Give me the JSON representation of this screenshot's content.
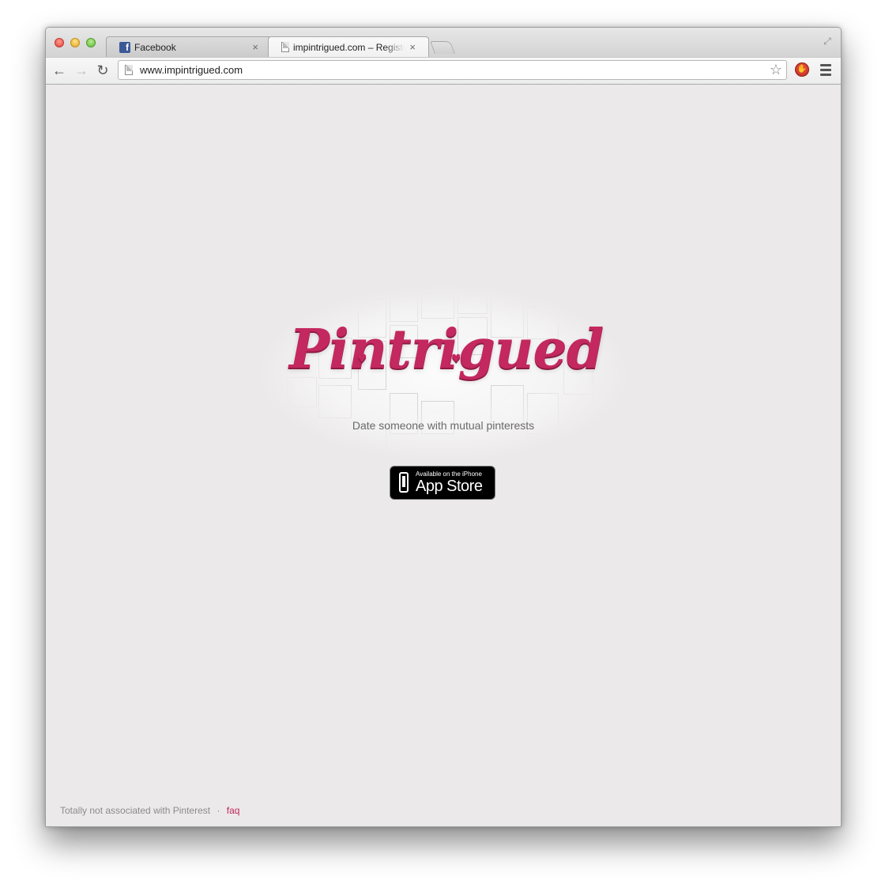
{
  "browser": {
    "tabs": [
      {
        "title": "Facebook",
        "icon": "facebook-icon",
        "active": false
      },
      {
        "title": "impintrigued.com – Register",
        "icon": "page-icon",
        "active": true
      }
    ],
    "url": "www.impintrigued.com",
    "close_glyph": "×"
  },
  "page": {
    "logo": "Pintrigued",
    "tagline": "Date someone with mutual pinterests",
    "appstore": {
      "small": "Available on the iPhone",
      "big": "App Store"
    },
    "footer": {
      "note": "Totally not associated with Pinterest",
      "separator": "·",
      "faq": "faq"
    }
  },
  "colors": {
    "brand": "#c3285e",
    "background": "#ebe9ea"
  }
}
